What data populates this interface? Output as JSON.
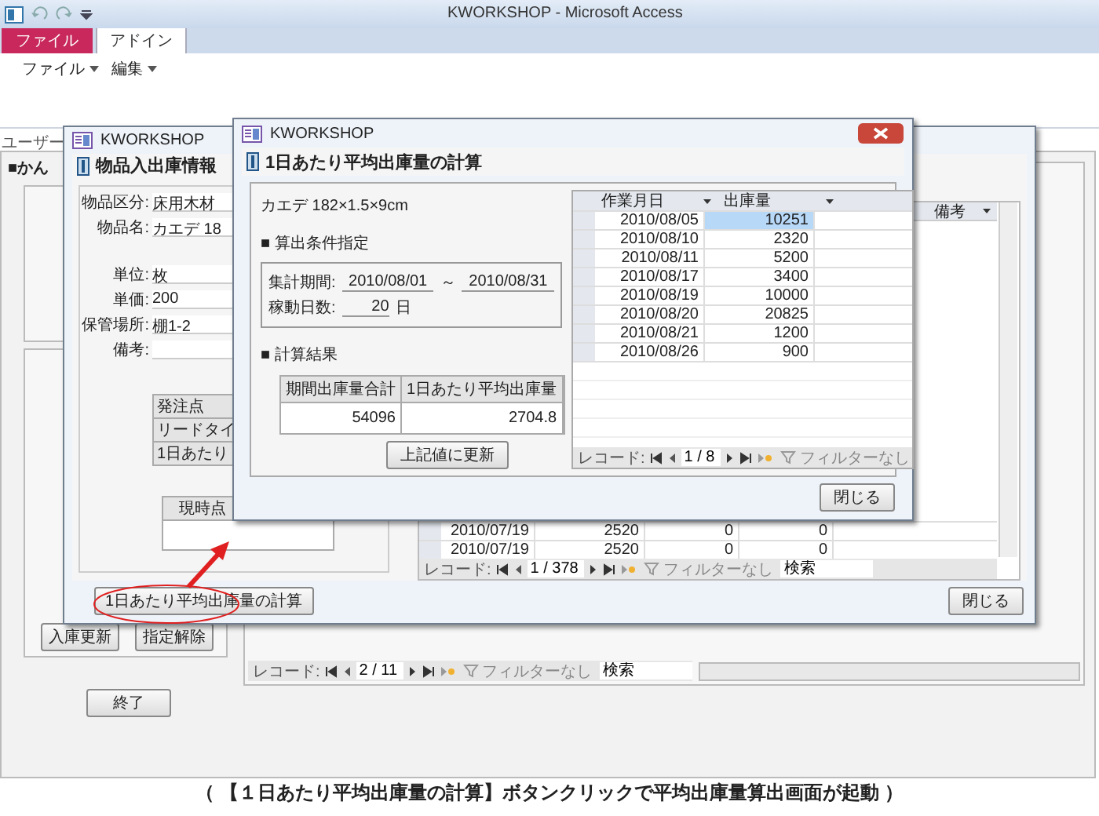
{
  "app": {
    "title": "KWORKSHOP - Microsoft Access",
    "ribbon_tabs": [
      {
        "label": "ファイル",
        "kind": "file",
        "selected": false
      },
      {
        "label": "アドイン",
        "kind": "tab",
        "selected": true
      }
    ],
    "ribbon_menus": [
      "ファイル",
      "編集"
    ],
    "nav_pane_label": "ユーザー"
  },
  "main_form": {
    "heading": "■かん",
    "buttons": [
      "入庫更新",
      "指定解除"
    ],
    "exit_button": "終了",
    "record_nav": {
      "label": "レコード:",
      "position": "2 / 11",
      "filter": "フィルターなし",
      "search": {
        "placeholder": "検索"
      }
    }
  },
  "item_window": {
    "title": "KWORKSHOP",
    "heading": "物品入出庫情報",
    "fields": [
      {
        "label": "物品区分:",
        "value": "床用木材"
      },
      {
        "label": "物品名:",
        "value": "カエデ 18"
      },
      {
        "label": "単位:",
        "value": "枚"
      },
      {
        "label": "単価:",
        "value": "200"
      },
      {
        "label": "保管場所:",
        "value": "棚1-2"
      },
      {
        "label": "備考:"
      }
    ],
    "stats_rows": [
      "発注点",
      "リードタイ",
      "1日あたり"
    ],
    "current_header": "現時点",
    "calc_button": "1日あたり平均出庫量の計算",
    "datasheet": {
      "column_header": "備考",
      "rows": [
        [
          "2010/07/19",
          "2520",
          "0",
          "0"
        ],
        [
          "2010/07/19",
          "2520",
          "0",
          "0"
        ]
      ],
      "nav": {
        "label": "レコード:",
        "position": "1 / 378",
        "filter": "フィルターなし",
        "search": {
          "placeholder": "検索"
        }
      }
    },
    "close_button": "閉じる"
  },
  "calc_window": {
    "title": "KWORKSHOP",
    "heading": "1日あたり平均出庫量の計算",
    "item": "カエデ 182×1.5×9cm",
    "condition_section": "■ 算出条件指定",
    "period_label": "集計期間:",
    "period_from": "2010/08/01",
    "period_sep": "～",
    "period_to": "2010/08/31",
    "days_label": "稼動日数:",
    "days_value": "20",
    "days_unit": "日",
    "result_section": "■ 計算結果",
    "result_columns": [
      "期間出庫量合計",
      "1日あたり平均出庫量"
    ],
    "result_values": [
      "54096",
      "2704.8"
    ],
    "update_button": "上記値に更新",
    "datasheet": {
      "columns": [
        "作業月日",
        "出庫量"
      ],
      "rows": [
        {
          "date": "2010/08/05",
          "qty": "10251",
          "selected": true
        },
        {
          "date": "2010/08/10",
          "qty": "2320",
          "selected": false
        },
        {
          "date": "2010/08/11",
          "qty": "5200",
          "selected": false
        },
        {
          "date": "2010/08/17",
          "qty": "3400",
          "selected": false
        },
        {
          "date": "2010/08/19",
          "qty": "10000",
          "selected": false
        },
        {
          "date": "2010/08/20",
          "qty": "20825",
          "selected": false
        },
        {
          "date": "2010/08/21",
          "qty": "1200",
          "selected": false
        },
        {
          "date": "2010/08/26",
          "qty": "900",
          "selected": false
        }
      ],
      "nav": {
        "label": "レコード:",
        "position": "1 / 8",
        "filter": "フィルターなし"
      }
    },
    "close_button": "閉じる"
  },
  "caption": "（ 【１日あたり平均出庫量の計算】ボタンクリックで平均出庫量算出画面が起動 ）"
}
